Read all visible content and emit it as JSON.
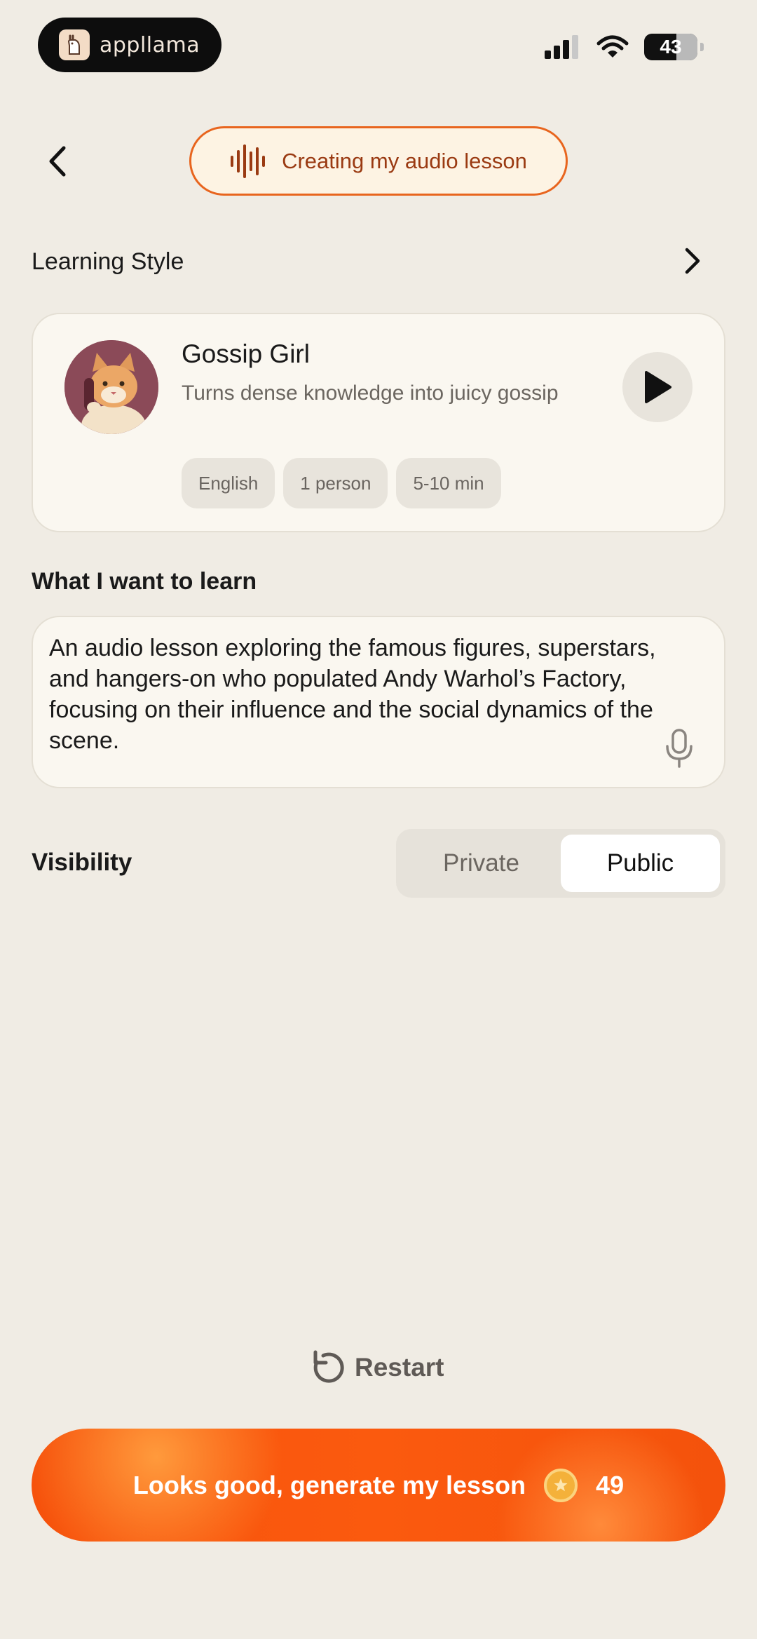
{
  "status_bar": {
    "app_name": "appllama",
    "battery_level": "43"
  },
  "header": {
    "status_text": "Creating my audio lesson"
  },
  "learning_style": {
    "section_title": "Learning Style",
    "card": {
      "name": "Gossip Girl",
      "description": "Turns dense knowledge into juicy gossip",
      "tags": [
        "English",
        "1 person",
        "5-10 min"
      ]
    }
  },
  "learn": {
    "section_title": "What I want to learn",
    "text": "An audio lesson exploring the famous figures, superstars, and hangers-on who populated Andy Warhol’s Factory, focusing on their influence and the social dynamics of the scene."
  },
  "visibility": {
    "section_title": "Visibility",
    "options": [
      "Private",
      "Public"
    ],
    "selected": "Public"
  },
  "restart_label": "Restart",
  "cta": {
    "label": "Looks good, generate my lesson",
    "coin_count": "49"
  },
  "colors": {
    "accent": "#f6520c",
    "chip_border": "#e8651e",
    "background": "#f0ece4"
  }
}
